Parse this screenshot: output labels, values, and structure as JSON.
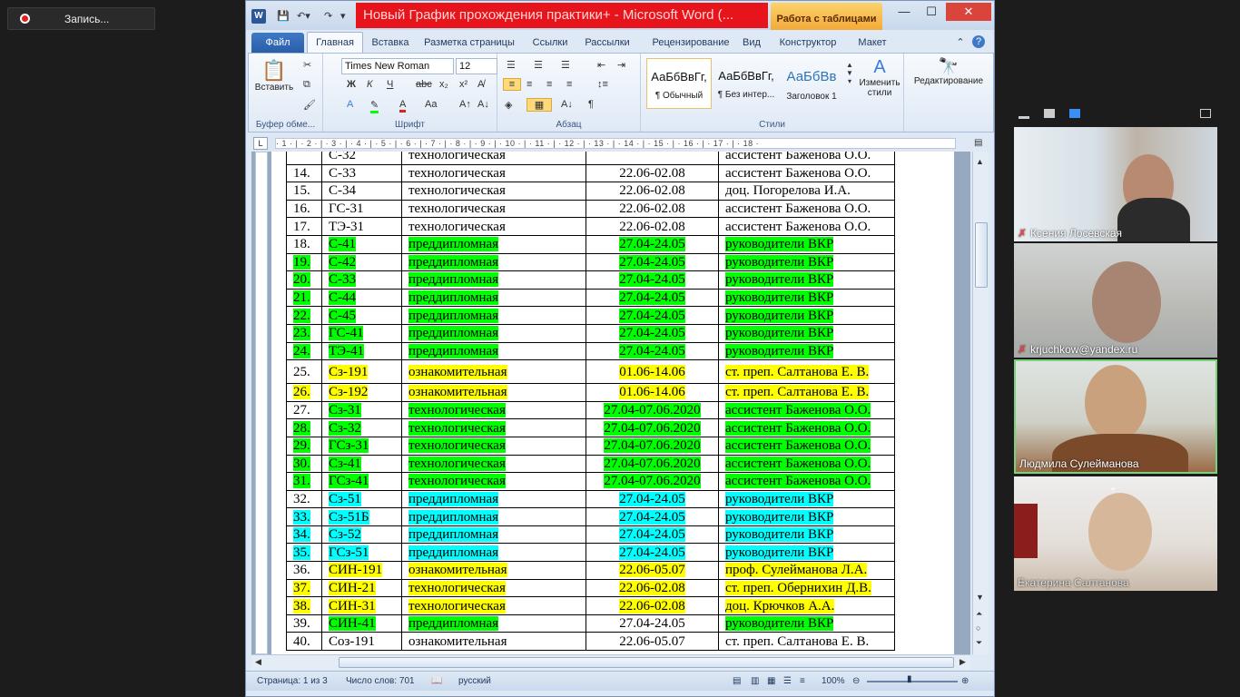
{
  "recording": {
    "label": "Запись..."
  },
  "window": {
    "title": "Новый График прохождения практики+ - Microsoft Word (...",
    "contextual_tab": "Работа с таблицами",
    "app_icon_letter": "W"
  },
  "tabs": [
    "Файл",
    "Главная",
    "Вставка",
    "Разметка страницы",
    "Ссылки",
    "Рассылки",
    "Рецензирование",
    "Вид",
    "Конструктор",
    "Макет"
  ],
  "ribbon": {
    "paste_label": "Вставить",
    "clipboard_label": "Буфер обме...",
    "font_name": "Times New Roman",
    "font_size": "12",
    "font_label": "Шрифт",
    "paragraph_label": "Абзац",
    "styles_label": "Стили",
    "styles": [
      {
        "preview": "АаБбВвГг,",
        "name": "¶ Обычный"
      },
      {
        "preview": "АаБбВвГг,",
        "name": "¶ Без интер..."
      },
      {
        "preview": "АаБбВв",
        "name": "Заголовок 1"
      }
    ],
    "change_styles": "Изменить стили",
    "editing": "Редактирование"
  },
  "ruler_text": "· 1 · | · 2 · | · 3 · | · 4 · | · 5 · | · 6 · | · 7 · | · 8 · | · 9 · | · 10 · | · 11 · | · 12 · | · 13 · | · 14 · | · 15 · | · 16 · | · 17 · | · 18 ·",
  "table": {
    "rows": [
      {
        "n": "",
        "group": "С-32",
        "type": "технологическая",
        "dates": "",
        "lead": "ассистент Баженова О.О.",
        "hl": ""
      },
      {
        "n": "14.",
        "group": "С-33",
        "type": "технологическая",
        "dates": "22.06-02.08",
        "lead": "ассистент Баженова О.О.",
        "hl": ""
      },
      {
        "n": "15.",
        "group": "С-34",
        "type": "технологическая",
        "dates": "22.06-02.08",
        "lead": "доц. Погорелова И.А.",
        "hl": ""
      },
      {
        "n": "16.",
        "group": "ГС-31",
        "type": "технологическая",
        "dates": "22.06-02.08",
        "lead": "ассистент Баженова О.О.",
        "hl": ""
      },
      {
        "n": "17.",
        "group": "ТЭ-31",
        "type": "технологическая",
        "dates": "22.06-02.08",
        "lead": "ассистент Баженова О.О.",
        "hl": ""
      },
      {
        "n": "18.",
        "group": "С-41",
        "type": "преддипломная",
        "dates": "27.04-24.05",
        "lead": "руководители ВКР",
        "hl": "g"
      },
      {
        "n": "19.",
        "group": "С-42",
        "type": "преддипломная",
        "dates": "27.04-24.05",
        "lead": "руководители ВКР",
        "hl": "g",
        "nhl": true
      },
      {
        "n": "20.",
        "group": "С-33",
        "type": "преддипломная",
        "dates": "27.04-24.05",
        "lead": "руководители ВКР",
        "hl": "g",
        "nhl": true
      },
      {
        "n": "21.",
        "group": "С-44",
        "type": "преддипломная",
        "dates": "27.04-24.05",
        "lead": "руководители ВКР",
        "hl": "g",
        "nhl": true
      },
      {
        "n": "22.",
        "group": "С-45",
        "type": "преддипломная",
        "dates": "27.04-24.05",
        "lead": "руководители ВКР",
        "hl": "g",
        "nhl": true
      },
      {
        "n": "23.",
        "group": "ГС-41",
        "type": "преддипломная",
        "dates": "27.04-24.05",
        "lead": "руководители ВКР",
        "hl": "g",
        "nhl": true
      },
      {
        "n": "24.",
        "group": "ТЭ-41",
        "type": "преддипломная",
        "dates": "27.04-24.05",
        "lead": "руководители ВКР",
        "hl": "g",
        "nhl": true
      },
      {
        "n": "25.",
        "group": "Сз-191",
        "type": "ознакомительная",
        "dates": "01.06-14.06",
        "lead": "ст. преп. Салтанова Е. В.",
        "hl": "y",
        "tall": true
      },
      {
        "n": "26.",
        "group": "Сз-192",
        "type": "ознакомительная",
        "dates": "01.06-14.06",
        "lead": "ст. преп. Салтанова Е. В.",
        "hl": "y",
        "nhl": true
      },
      {
        "n": "27.",
        "group": "Сз-31",
        "type": " технологическая",
        "dates": "27.04-07.06.2020",
        "lead": "ассистент Баженова О.О.",
        "hl": "g"
      },
      {
        "n": "28.",
        "group": "Сз-32",
        "type": "технологическая",
        "dates": "27.04-07.06.2020",
        "lead": "ассистент Баженова О.О.",
        "hl": "g",
        "nhl": true
      },
      {
        "n": "29.",
        "group": "ГСз-31",
        "type": "технологическая",
        "dates": "27.04-07.06.2020",
        "lead": "ассистент Баженова О.О.",
        "hl": "g",
        "nhl": true
      },
      {
        "n": "30.",
        "group": "Сз-41",
        "type": "технологическая",
        "dates": "27.04-07.06.2020",
        "lead": "ассистент Баженова О.О.",
        "hl": "g",
        "nhl": true
      },
      {
        "n": "31.",
        "group": "ГСз-41",
        "type": "технологическая",
        "dates": "27.04-07.06.2020",
        "lead": "ассистент Баженова О.О.",
        "hl": "g",
        "nhl": true
      },
      {
        "n": "32.",
        "group": "Сз-51",
        "type": "преддипломная",
        "dates": "27.04-24.05",
        "lead": "руководители ВКР",
        "hl": "c"
      },
      {
        "n": "33.",
        "group": "Сз-51Б",
        "type": "преддипломная",
        "dates": "27.04-24.05",
        "lead": "руководители ВКР",
        "hl": "c",
        "nhl": true
      },
      {
        "n": "34.",
        "group": "Сз-52",
        "type": "преддипломная",
        "dates": "27.04-24.05",
        "lead": "руководители ВКР",
        "hl": "c",
        "nhl": true
      },
      {
        "n": "35.",
        "group": "ГСз-51",
        "type": "преддипломная",
        "dates": "27.04-24.05",
        "lead": "руководители ВКР",
        "hl": "c",
        "nhl": true
      },
      {
        "n": "36.",
        "group": "СИН-191",
        "type": "ознакомительная",
        "dates": "22.06-05.07",
        "lead": "проф. Сулейманова Л.А.",
        "hl": "y"
      },
      {
        "n": "37.",
        "group": "СИН-21",
        "type": "технологическая",
        "dates": "22.06-02.08",
        "lead": "ст. преп. Обернихин Д.В.",
        "hl": "y",
        "nhl": true
      },
      {
        "n": "38.",
        "group": "СИН-31",
        "type": "технологическая",
        "dates": "22.06-02.08",
        "lead": "доц. Крючков А.А.",
        "hl": "y",
        "nhl": true
      },
      {
        "n": "39.",
        "group": "СИН-41",
        "type": "преддипломная",
        "dates": "27.04-24.05",
        "lead": "руководители ВКР",
        "hl": "g",
        "nodate": true
      },
      {
        "n": "40.",
        "group": "Соз-191",
        "type": "ознакомительная",
        "dates": "22.06-05.07",
        "lead": "ст. преп. Салтанова Е. В.",
        "hl": ""
      }
    ]
  },
  "status": {
    "page": "Страница: 1 из 3",
    "words": "Число слов: 701",
    "language": "русский",
    "zoom": "100%"
  },
  "participants": [
    {
      "name": "Ксения Лосевская",
      "muted": true
    },
    {
      "name": "krjuchkow@yandex.ru",
      "muted": true
    },
    {
      "name": "Людмила Сулейманова",
      "muted": false
    },
    {
      "name": "Екатерина Салтанова",
      "muted": false
    }
  ],
  "colors": {
    "highlight_green": "#00ff00",
    "highlight_yellow": "#ffff00",
    "highlight_cyan": "#00ffff",
    "title_red": "#e8141b"
  }
}
